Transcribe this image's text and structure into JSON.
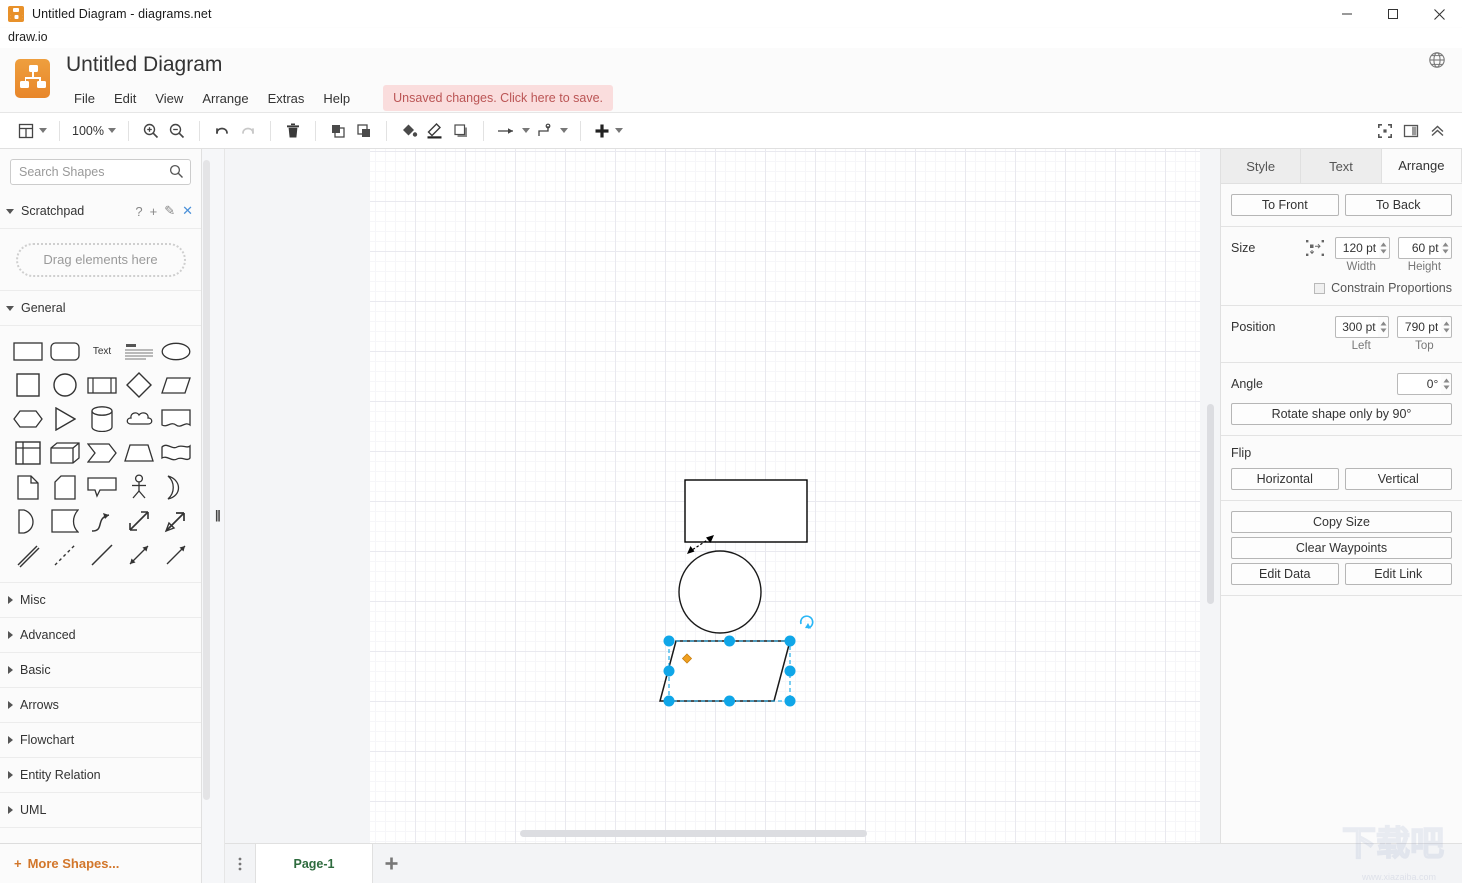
{
  "window": {
    "title": "Untitled Diagram - diagrams.net",
    "app_name": "draw.io",
    "minimize": "minimize-icon",
    "maximize": "maximize-icon",
    "close": "close-icon"
  },
  "header": {
    "document_title": "Untitled Diagram",
    "menus": [
      "File",
      "Edit",
      "View",
      "Arrange",
      "Extras",
      "Help"
    ],
    "unsaved_notice": "Unsaved changes. Click here to save.",
    "language_icon": "globe-icon",
    "accent_color": "#e8862a",
    "unsaved_color": "#b55555"
  },
  "toolbar": {
    "view_label": "view-dropdown",
    "zoom_value": "100%",
    "zoom_in": "zoom-in-icon",
    "zoom_out": "zoom-out-icon",
    "undo": "undo-icon",
    "redo": "redo-icon",
    "delete": "trash-icon",
    "to_front": "to-front-icon",
    "to_back": "to-back-icon",
    "fill_color": "fill-color-icon",
    "line_color": "line-color-icon",
    "shadow": "shadow-icon",
    "connection": "connection-arrow-icon",
    "waypoints": "waypoints-icon",
    "insert": "insert-plus-icon",
    "fullscreen": "fullscreen-icon",
    "format_panel": "format-panel-icon",
    "collapse": "collapse-chevrons-icon"
  },
  "sidebar": {
    "search": {
      "placeholder": "Search Shapes",
      "value": "",
      "icon": "search-icon"
    },
    "scratchpad": {
      "title": "Scratchpad",
      "drop_hint": "Drag elements here",
      "actions": [
        "?",
        "+",
        "✎",
        "✕"
      ]
    },
    "general": {
      "title": "General",
      "shapes": [
        "rectangle",
        "rounded-rectangle",
        "text",
        "textbox",
        "ellipse",
        "square",
        "circle",
        "process",
        "diamond",
        "parallelogram",
        "hexagon",
        "triangle",
        "cylinder",
        "cloud",
        "document",
        "internal-storage",
        "cube",
        "step",
        "trapezoid",
        "tape",
        "note",
        "card",
        "callout",
        "actor",
        "or",
        "and",
        "data-storage",
        "curve",
        "bidirectional-arrow",
        "arrow",
        "double-line",
        "dashed-line",
        "line",
        "bidirectional-connector",
        "directional-connector"
      ]
    },
    "sections": [
      "Misc",
      "Advanced",
      "Basic",
      "Arrows",
      "Flowchart",
      "Entity Relation",
      "UML"
    ],
    "more_shapes": "More Shapes...",
    "more_shapes_color": "#d2762a"
  },
  "format_panel": {
    "tabs": [
      {
        "label": "Style",
        "active": false
      },
      {
        "label": "Text",
        "active": false
      },
      {
        "label": "Arrange",
        "active": true
      }
    ],
    "order": {
      "to_front": "To Front",
      "to_back": "To Back"
    },
    "size": {
      "label": "Size",
      "icon": "auto-size-icon",
      "width": "120 pt",
      "height": "60 pt",
      "width_label": "Width",
      "height_label": "Height",
      "constrain_label": "Constrain Proportions",
      "constrain_checked": false
    },
    "position": {
      "label": "Position",
      "left": "300 pt",
      "top": "790 pt",
      "left_label": "Left",
      "top_label": "Top"
    },
    "angle": {
      "label": "Angle",
      "value": "0°",
      "rotate_button": "Rotate shape only by 90°"
    },
    "flip": {
      "label": "Flip",
      "horizontal": "Horizontal",
      "vertical": "Vertical"
    },
    "actions": {
      "copy_size": "Copy Size",
      "clear_waypoints": "Clear Waypoints",
      "edit_data": "Edit Data",
      "edit_link": "Edit Link"
    }
  },
  "canvas": {
    "shapes": [
      {
        "name": "rectangle-shape",
        "type": "rectangle",
        "selected": false
      },
      {
        "name": "circle-shape",
        "type": "ellipse",
        "selected": false
      },
      {
        "name": "parallelogram-shape",
        "type": "parallelogram",
        "selected": true
      }
    ],
    "connector": {
      "name": "arrow-connector",
      "type": "arrow"
    },
    "selection_handle_color": "#0fa6e8",
    "constraint_handle_color": "#f0a020",
    "rotate_icon": "rotate-handle-icon"
  },
  "tabbar": {
    "menu_icon": "page-menu-icon",
    "pages": [
      "Page-1"
    ],
    "add_page": "+",
    "active_page_color": "#2e6b3e"
  },
  "watermark": {
    "text": "www.xiazaiba.com"
  }
}
